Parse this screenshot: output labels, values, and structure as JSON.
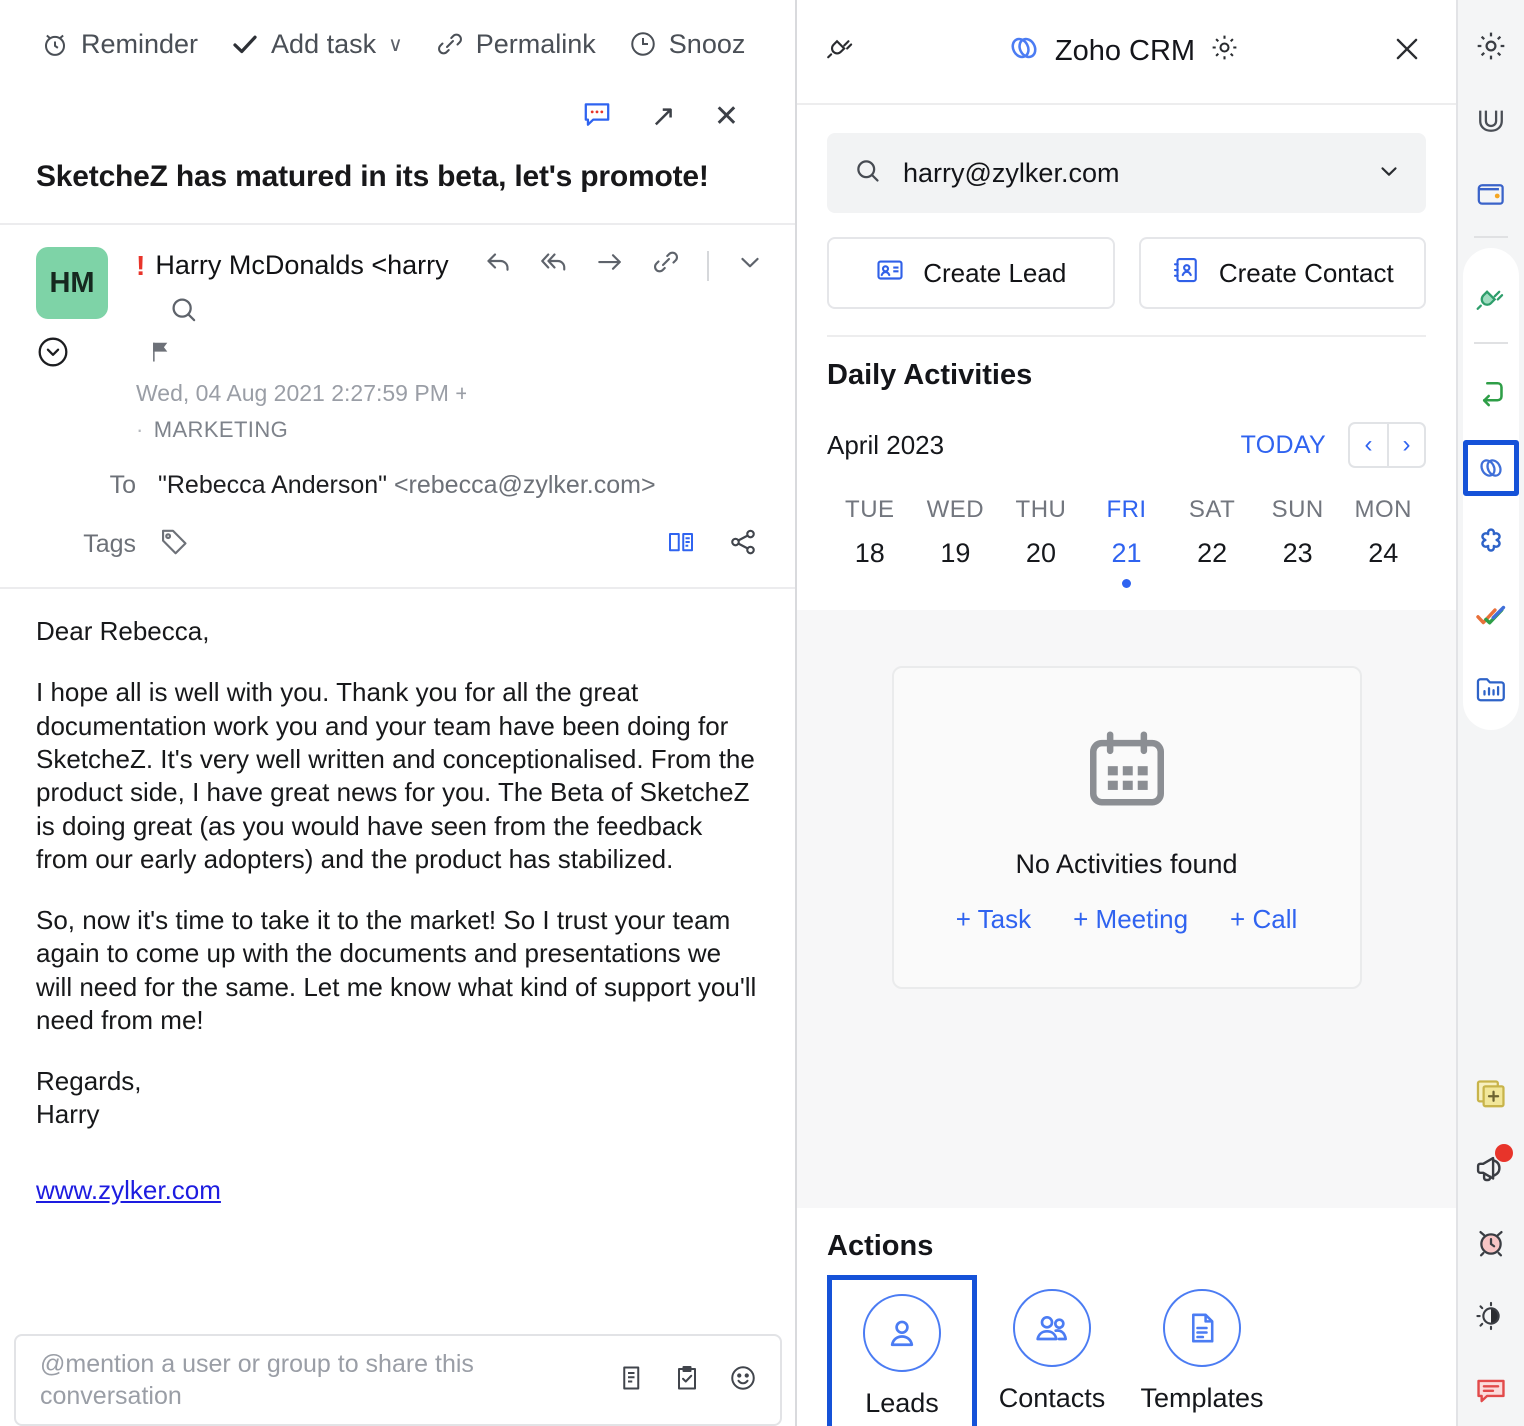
{
  "mail": {
    "toolbar": [
      {
        "label": "Reminder",
        "icon": "alarm-clock-icon"
      },
      {
        "label": "Add task",
        "icon": "check-icon",
        "caret": "∨"
      },
      {
        "label": "Permalink",
        "icon": "link-icon"
      },
      {
        "label": "Snooz",
        "icon": "clock-icon"
      }
    ],
    "window_actions": [
      {
        "name": "comment-icon"
      },
      {
        "name": "popout-icon",
        "glyph": "↗"
      },
      {
        "name": "close-icon",
        "glyph": "✕"
      }
    ],
    "subject": "SketcheZ has matured in its beta, let's promote!",
    "sender": {
      "avatar_initials": "HM",
      "priority_mark": "!",
      "name_and_email": "Harry McDonalds <harry",
      "date": "Wed, 04 Aug 2021 2:27:59 PM +(",
      "category_dot": "·",
      "category": "MARKETING"
    },
    "to_label": "To",
    "to_name": "\"Rebecca Anderson\" ",
    "to_email": "<rebecca@zylker.com>",
    "tags_label": "Tags",
    "body": {
      "greeting": "Dear Rebecca,",
      "paragraph1": "I hope all is well with you. Thank you for all the great documentation work you and your team have been doing for SketcheZ. It's very well written and conceptionalised. From the product side, I have great news for you. The Beta of SketcheZ is doing great (as you would have seen from the feedback from our early adopters) and the product has stabilized.",
      "paragraph2": "So, now it's time to take it to the market! So I trust your team again to come up with the documents and presentations we will need for the same. Let me know what kind of support you'll need from me!",
      "signoff": "Regards,",
      "signature": "Harry",
      "website": "www.zylker.com"
    },
    "comment_placeholder": "@mention a user or group to share this conversation"
  },
  "crm": {
    "title": "Zoho CRM",
    "search_value": "harry@zylker.com",
    "buttons": [
      {
        "label": "Create Lead",
        "icon": "id-card-icon"
      },
      {
        "label": "Create Contact",
        "icon": "contact-book-icon"
      }
    ],
    "daily_activities": {
      "heading": "Daily Activities",
      "month": "April 2023",
      "today_label": "TODAY",
      "prev_glyph": "‹",
      "next_glyph": "›",
      "days": [
        {
          "dow": "TUE",
          "num": "18",
          "selected": false,
          "has_dot": false
        },
        {
          "dow": "WED",
          "num": "19",
          "selected": false,
          "has_dot": false
        },
        {
          "dow": "THU",
          "num": "20",
          "selected": false,
          "has_dot": false
        },
        {
          "dow": "FRI",
          "num": "21",
          "selected": true,
          "has_dot": true
        },
        {
          "dow": "SAT",
          "num": "22",
          "selected": false,
          "has_dot": false
        },
        {
          "dow": "SUN",
          "num": "23",
          "selected": false,
          "has_dot": false
        },
        {
          "dow": "MON",
          "num": "24",
          "selected": false,
          "has_dot": false
        }
      ],
      "empty_label": "No Activities found",
      "empty_links": [
        "+ Task",
        "+ Meeting",
        "+ Call"
      ]
    },
    "actions": {
      "heading": "Actions",
      "items": [
        {
          "label": "Leads",
          "icon": "person-icon",
          "highlighted": true
        },
        {
          "label": "Contacts",
          "icon": "people-icon",
          "highlighted": false
        },
        {
          "label": "Templates",
          "icon": "document-icon",
          "highlighted": false
        }
      ]
    }
  },
  "rail": {
    "top": [
      {
        "name": "settings-gear-icon"
      },
      {
        "name": "zoho-writer-icon"
      },
      {
        "name": "wallet-icon"
      }
    ],
    "apps": [
      {
        "name": "plug-connector-icon",
        "highlighted": false
      },
      {
        "name": "flow-arrow-icon",
        "highlighted": false
      },
      {
        "name": "zoho-crm-link-icon",
        "highlighted": true
      },
      {
        "name": "zoho-projects-icon",
        "highlighted": false
      },
      {
        "name": "double-check-icon",
        "highlighted": false
      },
      {
        "name": "reports-folder-icon",
        "highlighted": false
      }
    ],
    "bottom": [
      {
        "name": "add-note-icon",
        "badge": false
      },
      {
        "name": "announcement-megaphone-icon",
        "badge": true
      },
      {
        "name": "alarm-reminder-icon",
        "badge": false
      },
      {
        "name": "theme-brightness-icon",
        "badge": false
      },
      {
        "name": "feedback-chat-icon",
        "badge": false
      }
    ]
  },
  "colors": {
    "accent_blue": "#2f63f0",
    "highlight_blue": "#1552d8",
    "avatar_green": "#7ed3a7",
    "priority_red": "#e8342a",
    "link_blue": "#1d1ce0"
  }
}
